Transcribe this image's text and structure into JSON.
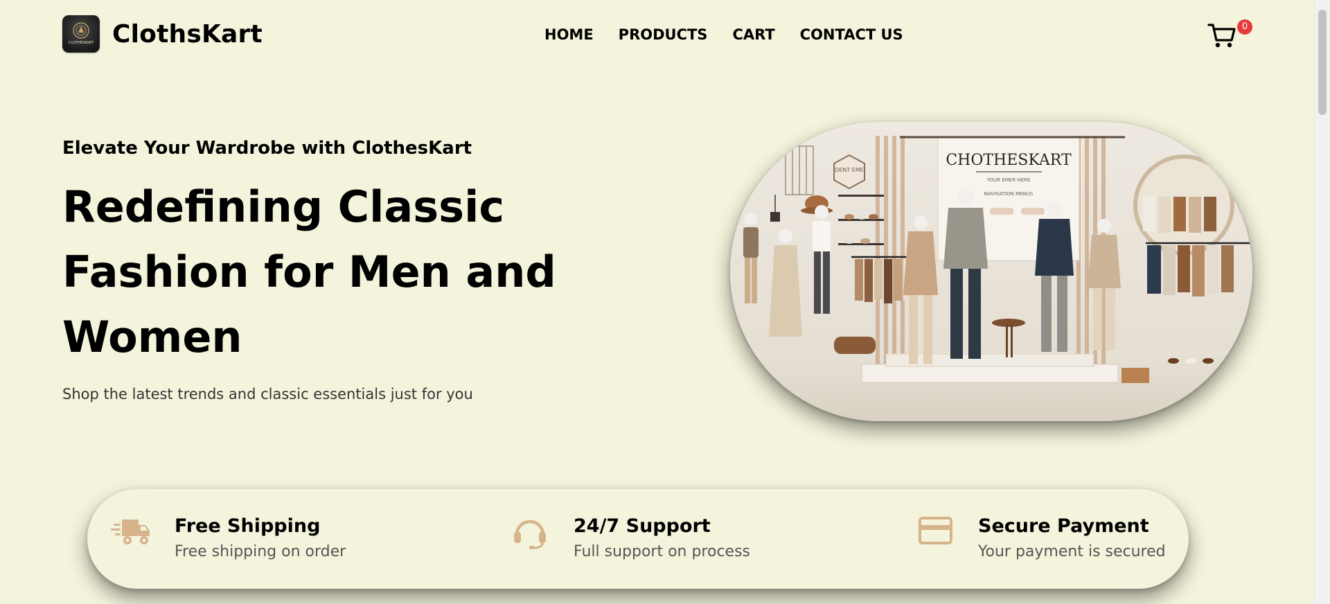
{
  "header": {
    "brand": "ClothsKart",
    "logo_text": "CLOTHESKART",
    "nav": [
      "HOME",
      "PRODUCTS",
      "CART",
      "CONTACT US"
    ],
    "cart_count": "0"
  },
  "hero": {
    "eyebrow": "Elevate Your Wardrobe with ClothesKart",
    "title": "Redefining Classic Fashion for Men and Women",
    "subtitle": "Shop the latest trends and classic essentials just for you",
    "image_sign": "CHOTHESKART",
    "image_sign_sub": "YOUR EMER HERE",
    "image_sign_sub2": "NAVIGATION MENUS",
    "image_plaque": "DENT EME"
  },
  "features": [
    {
      "icon": "truck-icon",
      "title": "Free Shipping",
      "desc": "Free shipping on order"
    },
    {
      "icon": "headset-icon",
      "title": "24/7 Support",
      "desc": "Full support on process"
    },
    {
      "icon": "credit-card-icon",
      "title": "Secure Payment",
      "desc": "Your payment is secured"
    }
  ],
  "colors": {
    "background": "#f4f3dc",
    "accent": "#d6b38a",
    "badge": "#e53b3b",
    "text": "#000000"
  }
}
